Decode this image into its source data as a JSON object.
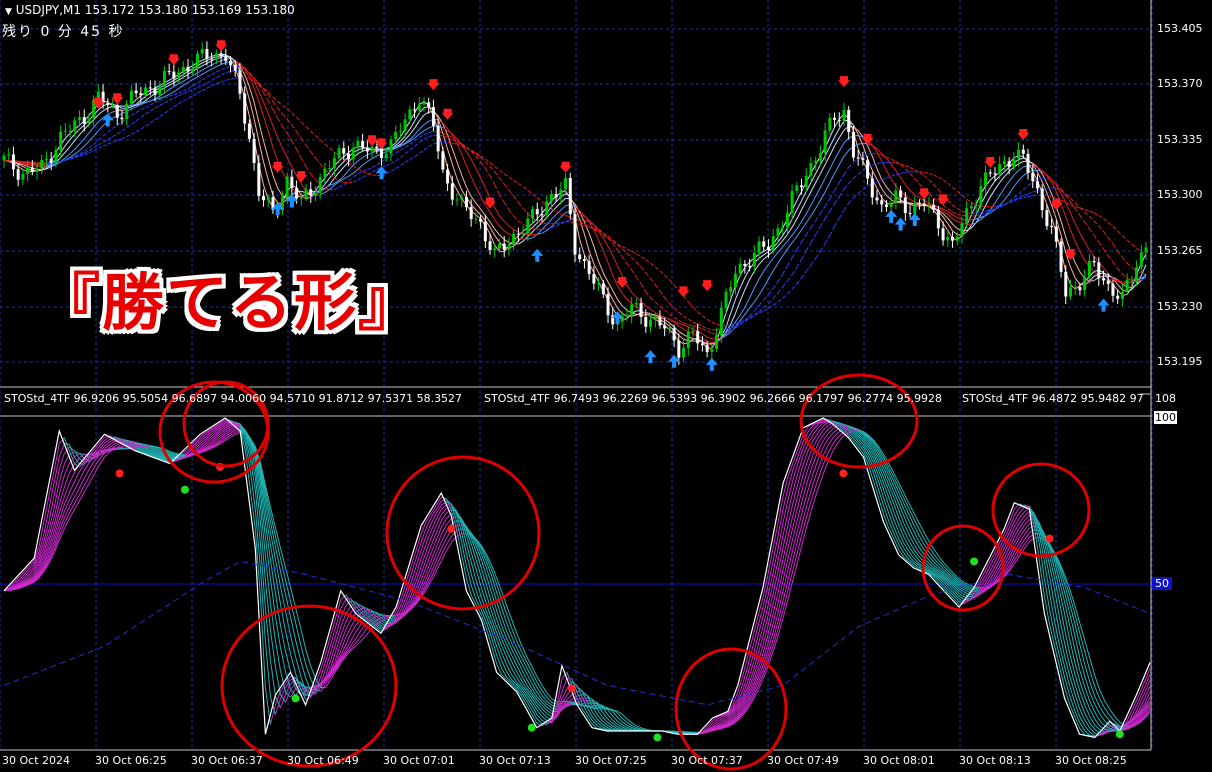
{
  "header": {
    "symbol": "USDJPY,M1",
    "ohlc": "153.172 153.180 153.169 153.180",
    "remaining": "残り 0 分 45 秒",
    "menu_icon": "triangle-down-icon"
  },
  "overlay_text": "『勝てる形』",
  "price_axis": {
    "ticks": [
      "153.405",
      "153.370",
      "153.335",
      "153.300",
      "153.265",
      "153.230",
      "153.195"
    ],
    "current_price": "153.180",
    "range": [
      153.18,
      153.415
    ]
  },
  "indicator": {
    "labels": [
      "STOStd_4TF 96.9206 95.5054 96.6897 94.0060 94.5710 91.8712 97.5371 58.3527",
      "STOStd_4TF 96.7493 96.2269 96.5393 96.3902 96.2666 96.1797 96.2774 95.9928",
      "STOStd_4TF 96.4872 95.9482 97"
    ],
    "level_108": "108",
    "level_100": "100",
    "level_50": "50",
    "range": [
      0,
      108
    ]
  },
  "time_axis": [
    "30 Oct 2024",
    "30 Oct 06:25",
    "30 Oct 06:37",
    "30 Oct 06:49",
    "30 Oct 07:01",
    "30 Oct 07:13",
    "30 Oct 07:25",
    "30 Oct 07:37",
    "30 Oct 07:49",
    "30 Oct 08:01",
    "30 Oct 08:13",
    "30 Oct 08:25"
  ],
  "colors": {
    "bull": "#00c800",
    "bear": "#ffffff",
    "grid": "#1c3a8a",
    "sell_arrow": "#ff1e1e",
    "buy_arrow": "#1e90ff",
    "stoch_up": "#d028d0",
    "stoch_down": "#20b4b4",
    "circle": "#e00000"
  },
  "chart_data": [
    {
      "type": "candlestick",
      "title": "USDJPY,M1",
      "x_range": [
        0,
        120
      ],
      "ylim": [
        153.18,
        153.415
      ],
      "close_path": [
        [
          0,
          153.33
        ],
        [
          4,
          153.322
        ],
        [
          8,
          153.325
        ],
        [
          12,
          153.345
        ],
        [
          16,
          153.355
        ],
        [
          20,
          153.37
        ],
        [
          24,
          153.36
        ],
        [
          28,
          153.372
        ],
        [
          32,
          153.378
        ],
        [
          36,
          153.385
        ],
        [
          40,
          153.393
        ],
        [
          44,
          153.398
        ],
        [
          47,
          153.398
        ],
        [
          50,
          153.372
        ],
        [
          52,
          153.345
        ],
        [
          54,
          153.31
        ],
        [
          57,
          153.295
        ],
        [
          60,
          153.318
        ],
        [
          63,
          153.302
        ],
        [
          66,
          153.315
        ],
        [
          70,
          153.33
        ],
        [
          74,
          153.34
        ],
        [
          78,
          153.335
        ],
        [
          82,
          153.34
        ],
        [
          86,
          153.36
        ],
        [
          88,
          153.372
        ],
        [
          91,
          153.352
        ],
        [
          93,
          153.322
        ],
        [
          97,
          153.3
        ],
        [
          101,
          153.29
        ],
        [
          104,
          153.268
        ],
        [
          108,
          153.282
        ],
        [
          112,
          153.292
        ],
        [
          116,
          153.308
        ],
        [
          119,
          153.312
        ],
        [
          121,
          153.275
        ],
        [
          124,
          153.258
        ],
        [
          127,
          153.24
        ],
        [
          130,
          153.225
        ],
        [
          133,
          153.235
        ],
        [
          136,
          153.23
        ],
        [
          140,
          153.222
        ],
        [
          143,
          153.21
        ],
        [
          146,
          153.218
        ],
        [
          149,
          153.205
        ],
        [
          152,
          153.232
        ],
        [
          155,
          153.258
        ],
        [
          158,
          153.268
        ],
        [
          162,
          153.275
        ],
        [
          166,
          153.298
        ],
        [
          170,
          153.322
        ],
        [
          173,
          153.338
        ],
        [
          176,
          153.358
        ],
        [
          178,
          153.362
        ],
        [
          180,
          153.335
        ],
        [
          183,
          153.318
        ],
        [
          186,
          153.3
        ],
        [
          189,
          153.305
        ],
        [
          192,
          153.3
        ],
        [
          195,
          153.302
        ],
        [
          198,
          153.29
        ],
        [
          201,
          153.275
        ],
        [
          204,
          153.295
        ],
        [
          207,
          153.315
        ],
        [
          211,
          153.325
        ],
        [
          214,
          153.335
        ],
        [
          216,
          153.33
        ],
        [
          219,
          153.31
        ],
        [
          222,
          153.285
        ],
        [
          225,
          153.245
        ],
        [
          228,
          153.252
        ],
        [
          231,
          153.262
        ],
        [
          234,
          153.25
        ],
        [
          237,
          153.24
        ],
        [
          240,
          153.265
        ],
        [
          242,
          153.275
        ]
      ],
      "sell_arrows": [
        [
          20,
          153.365
        ],
        [
          24,
          153.368
        ],
        [
          36,
          153.393
        ],
        [
          46,
          153.402
        ],
        [
          58,
          153.324
        ],
        [
          63,
          153.318
        ],
        [
          78,
          153.341
        ],
        [
          80,
          153.339
        ],
        [
          91,
          153.377
        ],
        [
          94,
          153.358
        ],
        [
          103,
          153.301
        ],
        [
          119,
          153.324
        ],
        [
          131,
          153.25
        ],
        [
          144,
          153.244
        ],
        [
          149,
          153.248
        ],
        [
          178,
          153.379
        ],
        [
          183,
          153.342
        ],
        [
          195,
          153.307
        ],
        [
          199,
          153.303
        ],
        [
          209,
          153.327
        ],
        [
          216,
          153.345
        ],
        [
          223,
          153.3
        ],
        [
          226,
          153.268
        ]
      ],
      "buy_arrows": [
        [
          22,
          153.357
        ],
        [
          58,
          153.3
        ],
        [
          61,
          153.305
        ],
        [
          80,
          153.323
        ],
        [
          113,
          153.27
        ],
        [
          130,
          153.23
        ],
        [
          137,
          153.205
        ],
        [
          142,
          153.202
        ],
        [
          150,
          153.2
        ],
        [
          188,
          153.295
        ],
        [
          190,
          153.29
        ],
        [
          193,
          153.293
        ],
        [
          233,
          153.238
        ]
      ],
      "ma_ribbon_up_color": "#4a9bff",
      "ma_ribbon_down_color": "#e01e1e"
    },
    {
      "type": "line",
      "title": "STOStd_4TF",
      "ylim": [
        0,
        108
      ],
      "series": [
        {
          "values": [
            [
              0,
              47
            ],
            [
              6,
              57
            ],
            [
              11,
              96
            ],
            [
              14,
              84
            ],
            [
              20,
              95
            ],
            [
              26,
              90
            ],
            [
              33,
              86
            ],
            [
              39,
              95
            ],
            [
              44,
              100
            ],
            [
              47,
              96
            ],
            [
              50,
              60
            ],
            [
              52,
              3
            ],
            [
              54,
              15
            ],
            [
              57,
              22
            ],
            [
              60,
              12
            ],
            [
              63,
              25
            ],
            [
              67,
              47
            ],
            [
              70,
              40
            ],
            [
              75,
              34
            ],
            [
              78,
              42
            ],
            [
              83,
              67
            ],
            [
              87,
              77
            ],
            [
              89,
              70
            ],
            [
              92,
              47
            ],
            [
              95,
              38
            ],
            [
              98,
              22
            ],
            [
              102,
              16
            ],
            [
              106,
              5
            ],
            [
              109,
              8
            ],
            [
              111,
              24
            ],
            [
              114,
              12
            ],
            [
              117,
              5
            ],
            [
              120,
              4
            ],
            [
              124,
              4
            ],
            [
              128,
              4
            ],
            [
              131,
              4
            ],
            [
              134,
              3
            ],
            [
              138,
              3
            ],
            [
              141,
              8
            ],
            [
              144,
              10
            ],
            [
              146,
              18
            ],
            [
              148,
              30
            ],
            [
              151,
              48
            ],
            [
              155,
              80
            ],
            [
              159,
              97
            ],
            [
              163,
              100
            ],
            [
              165,
              98
            ],
            [
              168,
              94
            ],
            [
              171,
              88
            ],
            [
              175,
              68
            ],
            [
              178,
              58
            ],
            [
              181,
              54
            ],
            [
              184,
              52
            ],
            [
              187,
              47
            ],
            [
              190,
              42
            ],
            [
              193,
              48
            ],
            [
              196,
              57
            ],
            [
              199,
              66
            ],
            [
              201,
              74
            ],
            [
              204,
              72
            ],
            [
              207,
              40
            ],
            [
              211,
              14
            ],
            [
              214,
              3
            ],
            [
              217,
              2
            ],
            [
              220,
              7
            ],
            [
              222,
              4
            ],
            [
              225,
              14
            ],
            [
              228,
              25
            ]
          ]
        }
      ],
      "ma_line": [
        [
          0,
          18
        ],
        [
          20,
          30
        ],
        [
          40,
          50
        ],
        [
          47,
          56
        ],
        [
          60,
          52
        ],
        [
          80,
          44
        ],
        [
          100,
          32
        ],
        [
          120,
          18
        ],
        [
          140,
          12
        ],
        [
          155,
          18
        ],
        [
          170,
          36
        ],
        [
          185,
          46
        ],
        [
          200,
          52
        ],
        [
          215,
          48
        ],
        [
          228,
          40
        ]
      ],
      "red_dots": [
        [
          23,
          83
        ],
        [
          43,
          85
        ],
        [
          89,
          66
        ],
        [
          113,
          17
        ],
        [
          167,
          83
        ],
        [
          208,
          63
        ]
      ],
      "green_dots": [
        [
          36,
          78
        ],
        [
          58,
          14
        ],
        [
          105,
          5
        ],
        [
          130,
          2
        ],
        [
          193,
          56
        ],
        [
          222,
          3
        ]
      ],
      "circles": [
        [
          40,
          88
        ],
        [
          95,
          66
        ],
        [
          58,
          14
        ],
        [
          167,
          92
        ],
        [
          192,
          40
        ],
        [
          204,
          68
        ],
        [
          143,
          8
        ]
      ]
    }
  ]
}
